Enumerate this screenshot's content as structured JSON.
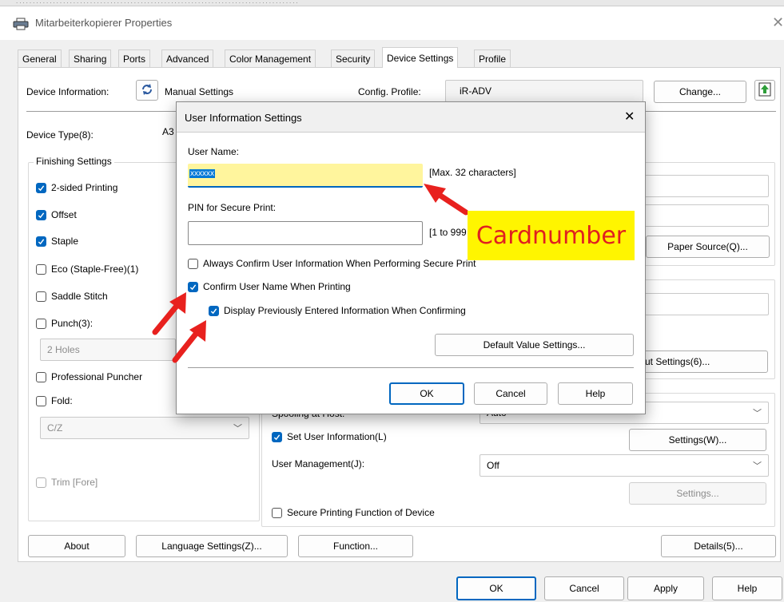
{
  "window": {
    "title": "Mitarbeiterkopierer Properties",
    "top_strip_text": "...................................................................................."
  },
  "tabs": [
    {
      "label": "General"
    },
    {
      "label": "Sharing"
    },
    {
      "label": "Ports"
    },
    {
      "label": "Advanced"
    },
    {
      "label": "Color Management"
    },
    {
      "label": "Security"
    },
    {
      "label": "Device Settings"
    },
    {
      "label": "Profile"
    }
  ],
  "device_info": {
    "label": "Device Information:",
    "manual": "Manual Settings",
    "config_label": "Config. Profile:",
    "config_value": "iR-ADV",
    "change": "Change..."
  },
  "device_type": {
    "label": "Device Type(8):",
    "value": "A3"
  },
  "finishing": {
    "legend": "Finishing Settings",
    "two_sided": "2-sided Printing",
    "offset": "Offset",
    "staple": "Staple",
    "eco": "Eco (Staple-Free)(1)",
    "saddle": "Saddle Stitch",
    "punch": "Punch(3):",
    "punch_value": "2 Holes",
    "professional": "Professional Puncher",
    "fold": "Fold:",
    "fold_value": "C/Z",
    "trim": "Trim [Fore]"
  },
  "right_panel": {
    "paper_source": "Paper Source(Q)...",
    "output_settings": "ut Settings(6)...",
    "spooling_label": "Spooling at Host:",
    "spooling_value": "Auto",
    "set_user_info": "Set User Information(L)",
    "settings_w": "Settings(W)...",
    "user_mgmt_label": "User Management(J):",
    "user_mgmt_value": "Off",
    "settings_disabled": "Settings...",
    "secure_printing": "Secure Printing Function of Device"
  },
  "bottom_row": {
    "about": "About",
    "language": "Language Settings(Z)...",
    "function": "Function...",
    "details": "Details(5)..."
  },
  "footer": {
    "ok": "OK",
    "cancel": "Cancel",
    "apply": "Apply",
    "help": "Help"
  },
  "dialog": {
    "title": "User Information Settings",
    "user_name_label": "User Name:",
    "user_name_value": "xxxxxx",
    "user_name_hint": "[Max. 32 characters]",
    "pin_label": "PIN for Secure Print:",
    "pin_value": "",
    "pin_hint": "[1 to 999",
    "always_confirm": "Always Confirm User Information When Performing Secure Print",
    "confirm_user_name": "Confirm User Name When Printing",
    "display_previous": "Display Previously Entered Information When Confirming",
    "default_value": "Default Value Settings...",
    "ok": "OK",
    "cancel": "Cancel",
    "help": "Help"
  },
  "annotation": {
    "text": "Cardnumber",
    "bg": "#fff500",
    "fg": "#e02020"
  },
  "colors": {
    "accent": "#0067c0",
    "arrow": "#e8211e",
    "highlight": "#fff59d"
  }
}
